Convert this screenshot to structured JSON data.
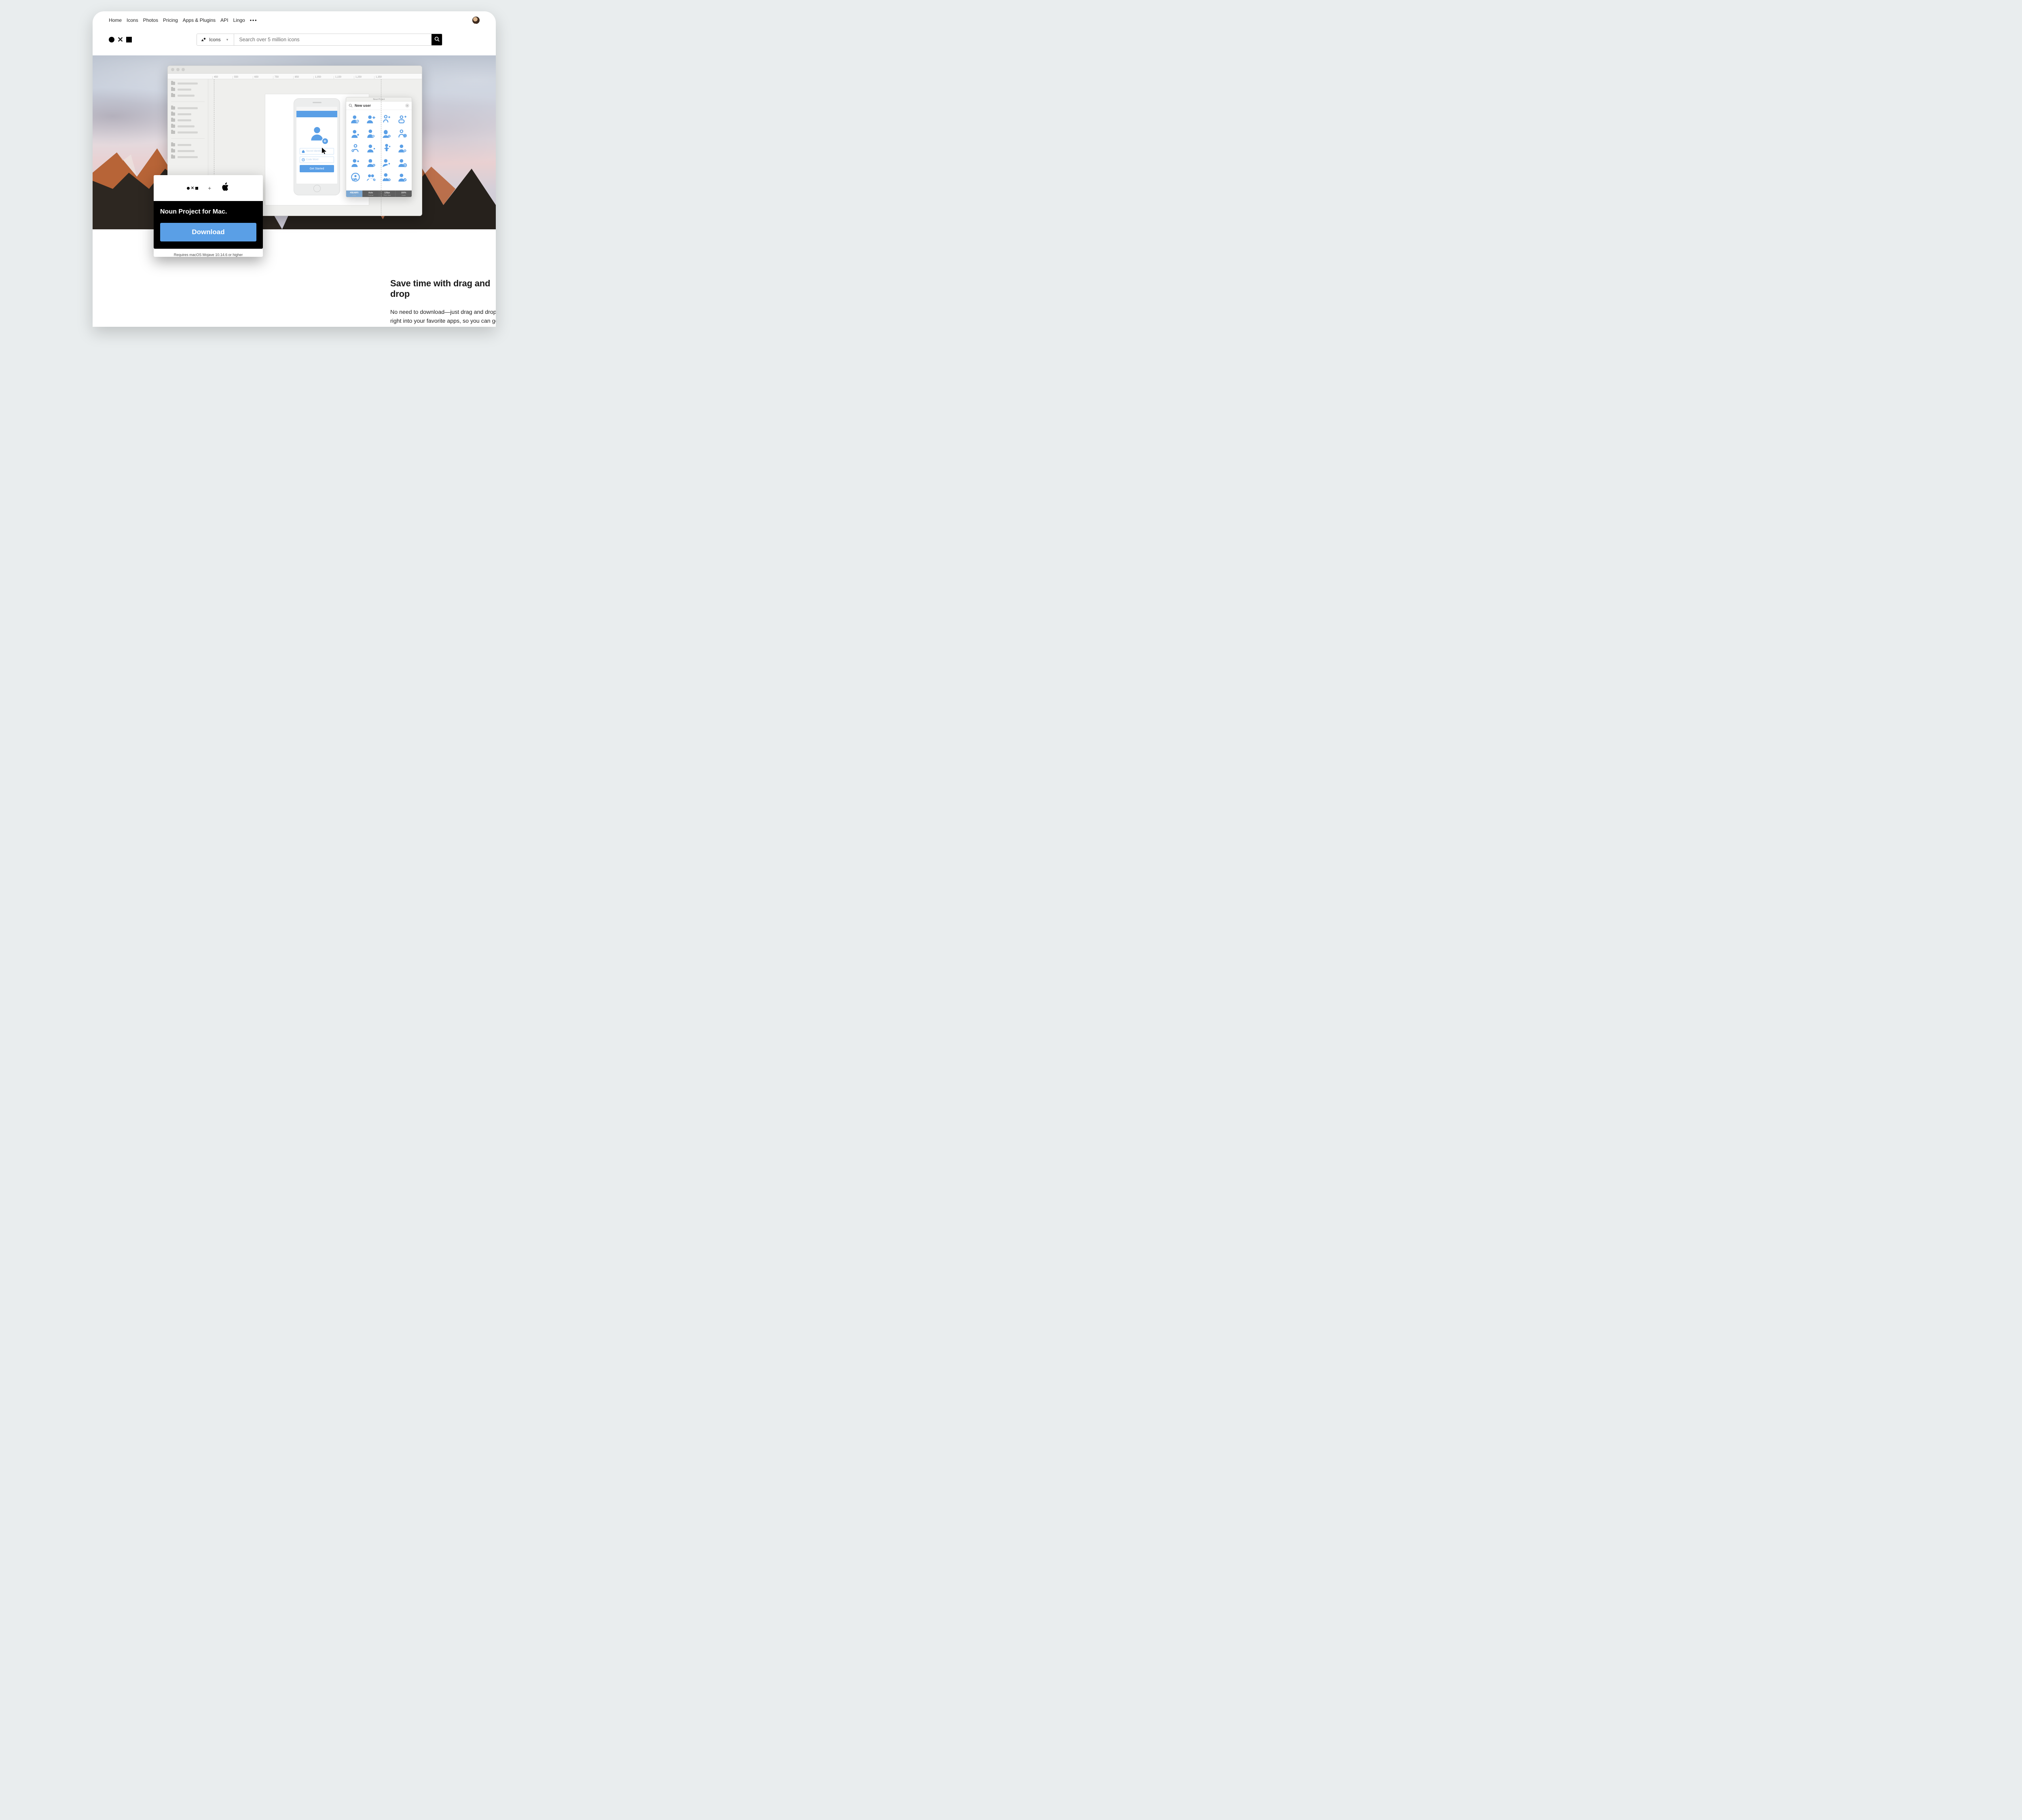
{
  "nav": {
    "items": [
      "Home",
      "Icons",
      "Photos",
      "Pricing",
      "Apps & Plugins",
      "API",
      "Lingo"
    ]
  },
  "search": {
    "filter_label": "Icons",
    "placeholder": "Search over 5 million icons"
  },
  "appwin": {
    "ruler_ticks": [
      "450",
      "550",
      "650",
      "750",
      "850",
      "1,050",
      "1,150",
      "1,250",
      "1,350"
    ],
    "phone": {
      "field1": "Secret Identity",
      "field2": "Code Word",
      "start": "Get Started"
    },
    "picker": {
      "title": "Noun Project",
      "search": "New user",
      "icons": 20,
      "footer": [
        {
          "value": "#5EA8F5",
          "label": "Color"
        },
        {
          "value": "Auto",
          "label": "Format"
        },
        {
          "value": "128px",
          "label": "PNG Size"
        },
        {
          "value": "100%",
          "label": "Zoom"
        }
      ]
    }
  },
  "download_card": {
    "title": "Noun Project for Mac.",
    "button": "Download",
    "requirement": "Requires macOS Mojave 10.14.6 or higher"
  },
  "feature": {
    "heading": "Save time with drag and drop",
    "body": "No need to download—just drag and drop icons right into your favorite apps, so you can get more done in your day. Choose between SVG, PNG, or PDF formats."
  }
}
